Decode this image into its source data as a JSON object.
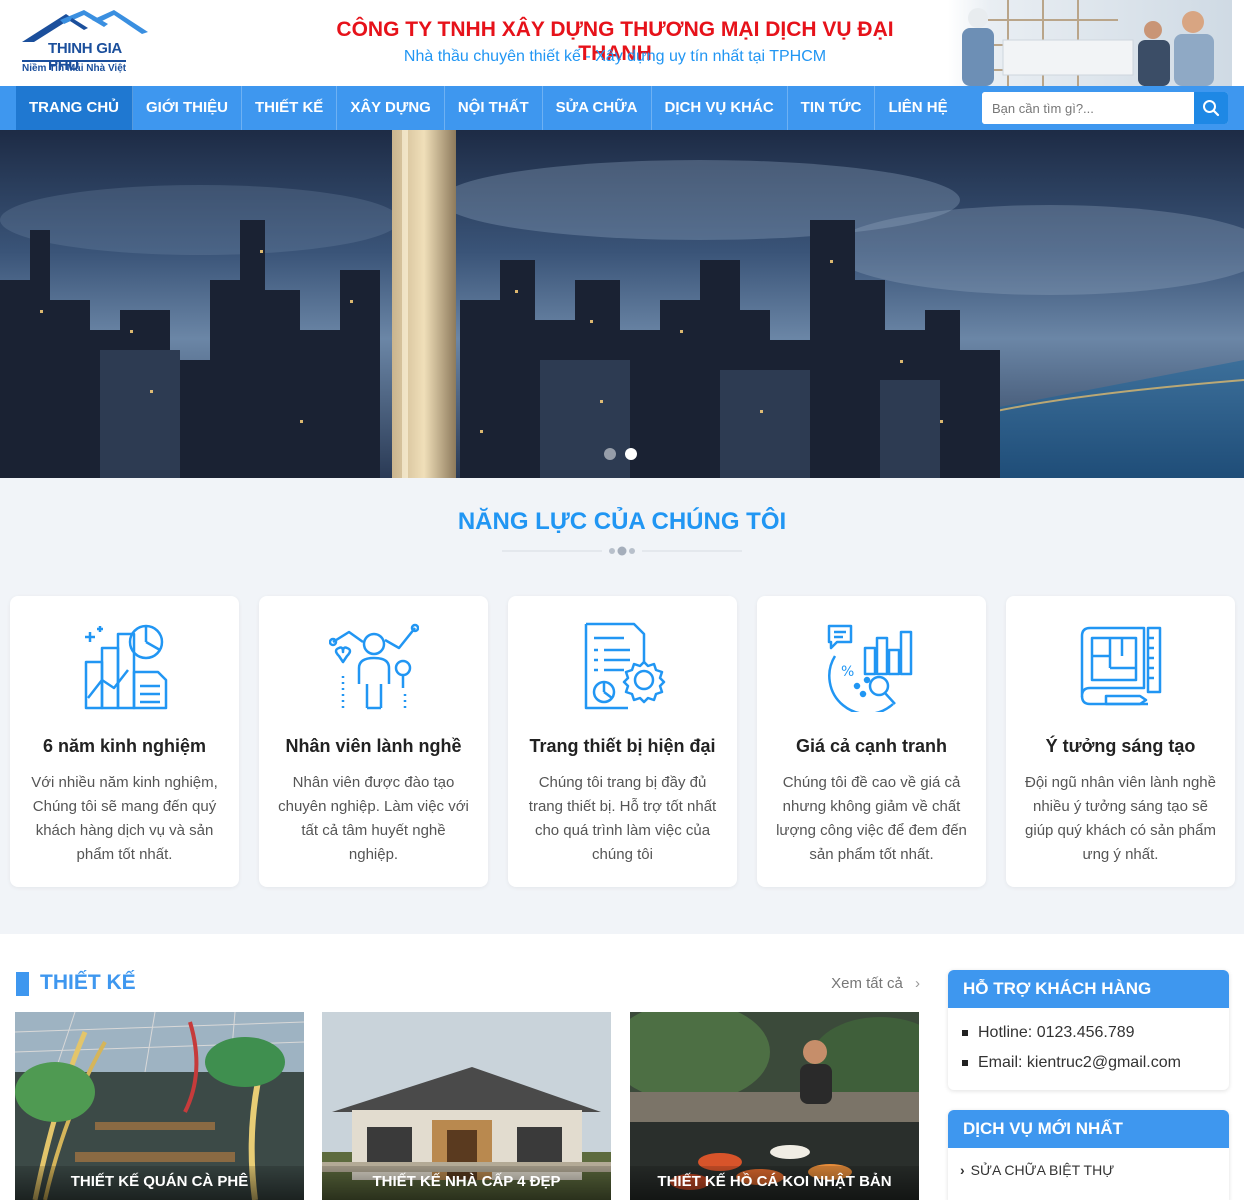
{
  "header": {
    "logo_name": "THINH GIA PHU",
    "logo_slogan": "Niềm Tin Mái Nhà Việt",
    "company_name": "CÔNG TY TNHH XÂY DỰNG THƯƠNG MẠI DỊCH VỤ ĐẠI THANH",
    "tagline": "Nhà thầu chuyên thiết kế - Xây dựng uy tín nhất tại TPHCM"
  },
  "nav": {
    "items": [
      "TRANG CHỦ",
      "GIỚI THIỆU",
      "THIẾT KẾ",
      "XÂY DỰNG",
      "NỘI THẤT",
      "SỬA CHỮA",
      "DỊCH VỤ KHÁC",
      "TIN TỨC",
      "LIÊN HỆ"
    ],
    "active": "TRANG CHỦ",
    "search_placeholder": "Bạn cần tìm gì?..."
  },
  "banner": {
    "slides": 2,
    "active_slide": 2
  },
  "capabilities": {
    "title": "NĂNG LỰC CỦA CHÚNG TÔI",
    "cards": [
      {
        "icon": "chart-growth-icon",
        "title": "6 năm kinh nghiệm",
        "text": "Với nhiều năm kinh nghiệm, Chúng tôi sẽ mang đến quý khách hàng dịch vụ và sản phẩm tốt nhất."
      },
      {
        "icon": "skilled-worker-icon",
        "title": "Nhân viên lành nghề",
        "text": "Nhân viên được đào tạo chuyên nghiệp. Làm việc với tất cả tâm huyết nghề nghiệp."
      },
      {
        "icon": "document-gear-icon",
        "title": "Trang thiết bị hiện đại",
        "text": "Chúng tôi trang bị đầy đủ trang thiết bị. Hỗ trợ tốt nhất cho quá trình làm việc của chúng tôi"
      },
      {
        "icon": "price-analysis-icon",
        "title": "Giá cả cạnh tranh",
        "text": "Chúng tôi đề cao về giá cả nhưng không giảm về chất lượng công việc để đem đến sản phẩm tốt nhất."
      },
      {
        "icon": "blueprint-icon",
        "title": "Ý tưởng sáng tạo",
        "text": "Đội ngũ nhân viên lành nghề nhiều ý tưởng sáng tạo sẽ giúp quý khách có sản phẩm ưng ý nhất."
      }
    ]
  },
  "design": {
    "title": "THIẾT KẾ",
    "see_all": "Xem tất cả",
    "items": [
      "THIẾT KẾ QUÁN CÀ PHÊ",
      "THIẾT KẾ NHÀ CẤP 4 ĐẸP",
      "THIẾT KẾ HỒ CÁ KOI NHẬT BẢN"
    ]
  },
  "sidebar": {
    "support_title": "HỖ TRỢ KHÁCH HÀNG",
    "hotline": "Hotline: 0123.456.789",
    "email": "Email: kientruc2@gmail.com",
    "services_title": "DỊCH VỤ MỚI NHẤT",
    "services": [
      "SỬA CHỮA BIỆT THỰ"
    ]
  },
  "colors": {
    "primary": "#3e97ef",
    "accent_red": "#e6121a",
    "title_blue": "#2196f3"
  }
}
